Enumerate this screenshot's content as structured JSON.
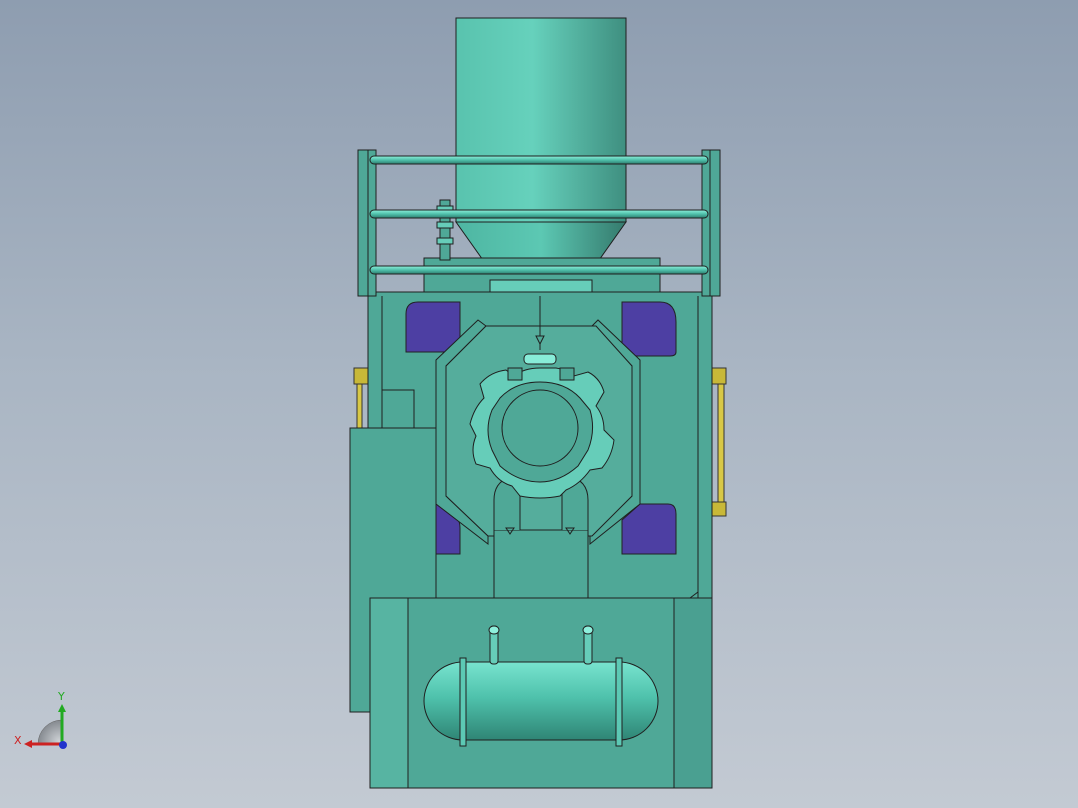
{
  "viewport": {
    "background_top": "#8e9db0",
    "background_bottom": "#c3cad3",
    "model_color": "#4fa897",
    "model_light": "#66cdb9",
    "window_color": "#4d3fa3",
    "accent_yellow": "#c8b838"
  },
  "triad": {
    "x_label": "X",
    "y_label": "Y",
    "x_color": "#cc2222",
    "y_color": "#22aa22",
    "z_color": "#2233cc"
  }
}
